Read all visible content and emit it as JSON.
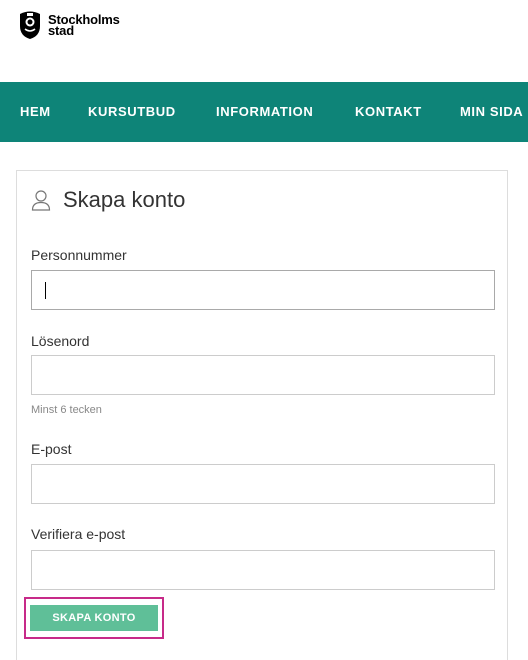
{
  "brand": {
    "line1": "Stockholms",
    "line2": "stad"
  },
  "nav": {
    "items": [
      {
        "label": "HEM"
      },
      {
        "label": "KURSUTBUD"
      },
      {
        "label": "INFORMATION"
      },
      {
        "label": "KONTAKT"
      },
      {
        "label": "MIN SIDA"
      }
    ],
    "background": "#0e8478"
  },
  "form": {
    "title": "Skapa konto",
    "icon": "user-icon",
    "fields": [
      {
        "label": "Personnummer",
        "value": ""
      },
      {
        "label": "Lösenord",
        "value": "",
        "help": "Minst 6 tecken"
      },
      {
        "label": "E-post",
        "value": ""
      },
      {
        "label": "Verifiera e-post",
        "value": ""
      }
    ],
    "submit_label": "SKAPA KONTO",
    "submit_color": "#5fbf98",
    "highlight_color": "#c72a89"
  }
}
